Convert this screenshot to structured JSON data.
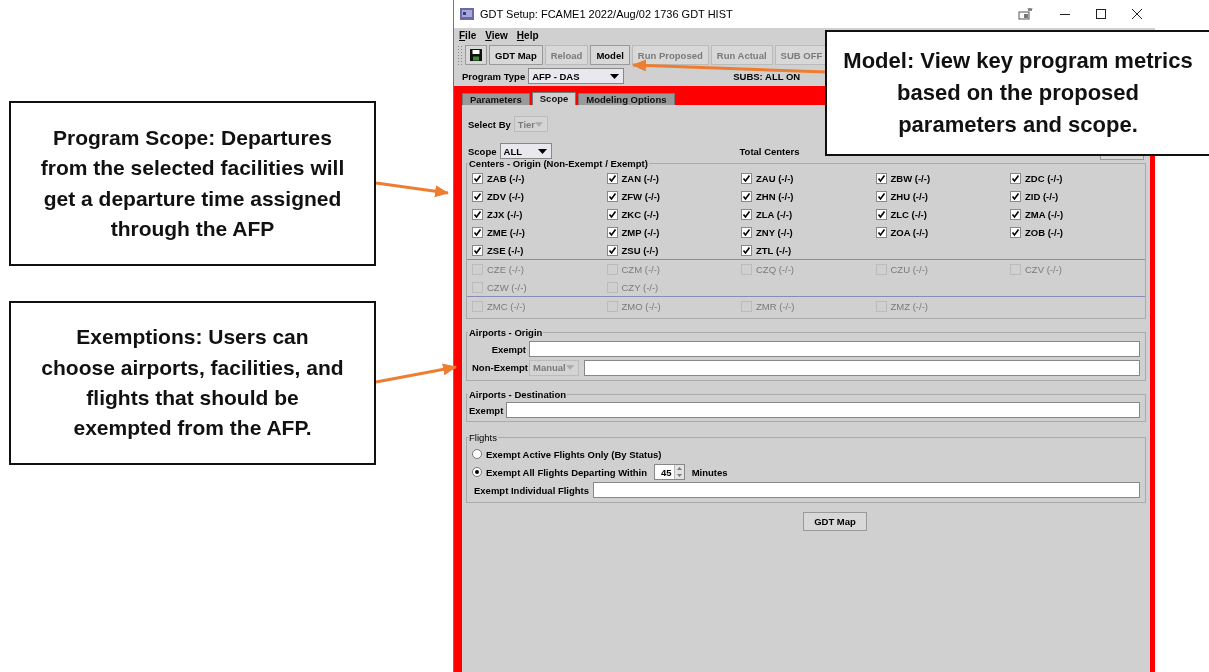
{
  "window": {
    "title": "GDT Setup: FCAME1 2022/Aug/02 1736 GDT HIST"
  },
  "menu": [
    {
      "label": "File"
    },
    {
      "label": "View"
    },
    {
      "label": "Help"
    }
  ],
  "toolbar": [
    {
      "label": "GDT Map",
      "disabled": false
    },
    {
      "label": "Reload",
      "disabled": true
    },
    {
      "label": "Model",
      "disabled": false
    },
    {
      "label": "Run Proposed",
      "disabled": true
    },
    {
      "label": "Run Actual",
      "disabled": true
    },
    {
      "label": "SUB OFF",
      "disabled": true
    }
  ],
  "program_type": {
    "label": "Program Type",
    "value": "AFP - DAS"
  },
  "subs": "SUBS: ALL ON",
  "tabs": [
    {
      "label": "Parameters",
      "selected": false
    },
    {
      "label": "Scope",
      "selected": true
    },
    {
      "label": "Modeling Options",
      "selected": false
    }
  ],
  "select_by": {
    "label": "Select By",
    "value": "Tier",
    "disabled": true
  },
  "scope": {
    "label": "Scope",
    "value": "ALL",
    "disabled": false
  },
  "total_centers": "Total Centers",
  "centers": {
    "title": "Centers - Origin (Non-Exempt / Exempt)",
    "groups": [
      [
        {
          "label": "ZAB (-/-)",
          "checked": true,
          "disabled": false
        },
        {
          "label": "ZAN (-/-)",
          "checked": true,
          "disabled": false
        },
        {
          "label": "ZAU (-/-)",
          "checked": true,
          "disabled": false
        },
        {
          "label": "ZBW (-/-)",
          "checked": true,
          "disabled": false
        },
        {
          "label": "ZDC (-/-)",
          "checked": true,
          "disabled": false
        },
        {
          "label": "ZDV (-/-)",
          "checked": true,
          "disabled": false
        },
        {
          "label": "ZFW (-/-)",
          "checked": true,
          "disabled": false
        },
        {
          "label": "ZHN (-/-)",
          "checked": true,
          "disabled": false
        },
        {
          "label": "ZHU (-/-)",
          "checked": true,
          "disabled": false
        },
        {
          "label": "ZID (-/-)",
          "checked": true,
          "disabled": false
        },
        {
          "label": "ZJX (-/-)",
          "checked": true,
          "disabled": false
        },
        {
          "label": "ZKC (-/-)",
          "checked": true,
          "disabled": false
        },
        {
          "label": "ZLA (-/-)",
          "checked": true,
          "disabled": false
        },
        {
          "label": "ZLC (-/-)",
          "checked": true,
          "disabled": false
        },
        {
          "label": "ZMA (-/-)",
          "checked": true,
          "disabled": false
        },
        {
          "label": "ZME (-/-)",
          "checked": true,
          "disabled": false
        },
        {
          "label": "ZMP (-/-)",
          "checked": true,
          "disabled": false
        },
        {
          "label": "ZNY (-/-)",
          "checked": true,
          "disabled": false
        },
        {
          "label": "ZOA (-/-)",
          "checked": true,
          "disabled": false
        },
        {
          "label": "ZOB (-/-)",
          "checked": true,
          "disabled": false
        },
        {
          "label": "ZSE (-/-)",
          "checked": true,
          "disabled": false
        },
        {
          "label": "ZSU (-/-)",
          "checked": true,
          "disabled": false
        },
        {
          "label": "ZTL (-/-)",
          "checked": true,
          "disabled": false
        }
      ],
      [
        {
          "label": "CZE (-/-)",
          "checked": false,
          "disabled": true
        },
        {
          "label": "CZM (-/-)",
          "checked": false,
          "disabled": true
        },
        {
          "label": "CZQ (-/-)",
          "checked": false,
          "disabled": true
        },
        {
          "label": "CZU (-/-)",
          "checked": false,
          "disabled": true
        },
        {
          "label": "CZV (-/-)",
          "checked": false,
          "disabled": true
        },
        {
          "label": "CZW (-/-)",
          "checked": false,
          "disabled": true
        },
        {
          "label": "CZY (-/-)",
          "checked": false,
          "disabled": true
        }
      ],
      [
        {
          "label": "ZMC (-/-)",
          "checked": false,
          "disabled": true
        },
        {
          "label": "ZMO (-/-)",
          "checked": false,
          "disabled": true
        },
        {
          "label": "ZMR (-/-)",
          "checked": false,
          "disabled": true
        },
        {
          "label": "ZMZ (-/-)",
          "checked": false,
          "disabled": true
        }
      ]
    ]
  },
  "airports_origin": {
    "title": "Airports - Origin",
    "exempt_label": "Exempt",
    "non_exempt_label": "Non-Exempt",
    "non_exempt_mode": {
      "value": "Manual",
      "disabled": true
    }
  },
  "airports_destination": {
    "title": "Airports - Destination",
    "exempt_label": "Exempt"
  },
  "flights": {
    "title": "Flights",
    "options": [
      {
        "label": "Exempt Active Flights Only (By Status)",
        "selected": false
      },
      {
        "label": "Exempt All Flights Departing Within",
        "selected": true
      }
    ],
    "minutes": "45",
    "minutes_label": "Minutes",
    "individual_label": "Exempt Individual Flights"
  },
  "gdt_map_button": "GDT Map",
  "callouts": [
    {
      "text": "Program Scope: Departures from the selected facilities will get a departure time assigned through the AFP"
    },
    {
      "text": "Exemptions: Users can choose airports, facilities, and flights that should be exempted from the AFP."
    },
    {
      "text": "Model: View key program metrics based on the proposed parameters and scope."
    }
  ]
}
